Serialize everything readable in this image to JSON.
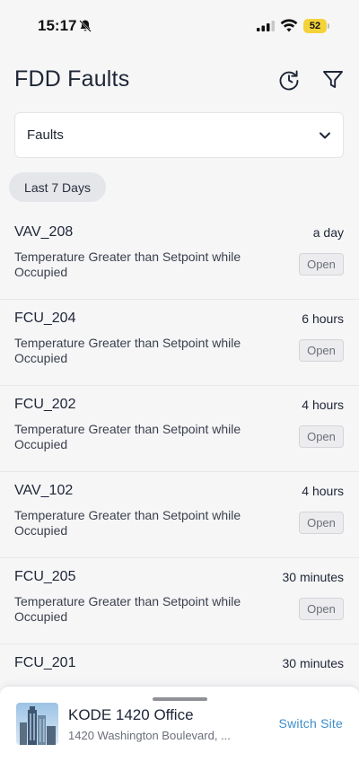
{
  "status_bar": {
    "time": "15:17",
    "battery": "52"
  },
  "header": {
    "title": "FDD Faults",
    "icons": [
      "refresh-clock-icon",
      "filter-icon"
    ]
  },
  "dropdown": {
    "value": "Faults"
  },
  "chip": {
    "label": "Last 7 Days"
  },
  "faults": [
    {
      "name": "VAV_208",
      "time": "a day",
      "description": "Temperature Greater than Setpoint while Occupied",
      "status": "Open"
    },
    {
      "name": "FCU_204",
      "time": "6 hours",
      "description": "Temperature Greater than Setpoint while Occupied",
      "status": "Open"
    },
    {
      "name": "FCU_202",
      "time": "4 hours",
      "description": "Temperature Greater than Setpoint while Occupied",
      "status": "Open"
    },
    {
      "name": "VAV_102",
      "time": "4 hours",
      "description": "Temperature Greater than Setpoint while Occupied",
      "status": "Open"
    },
    {
      "name": "FCU_205",
      "time": "30 minutes",
      "description": "Temperature Greater than Setpoint while Occupied",
      "status": "Open"
    },
    {
      "name": "FCU_201",
      "time": "30 minutes",
      "description": "",
      "status": ""
    }
  ],
  "site": {
    "name": "KODE 1420 Office",
    "address": "1420 Washington Boulevard, ...",
    "switch_label": "Switch Site"
  },
  "colors": {
    "accent": "#3d8ec9",
    "battery": "#f3d23a",
    "background": "#f6f6f7"
  }
}
